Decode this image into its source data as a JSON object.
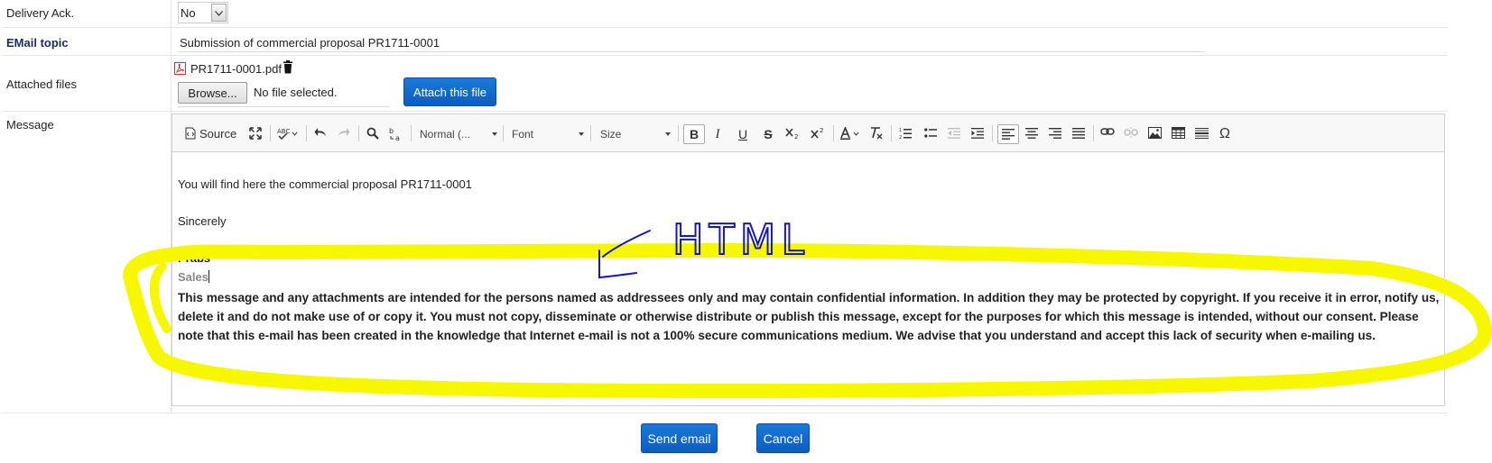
{
  "delivery_ack": {
    "label": "Delivery Ack.",
    "value": "No"
  },
  "email_topic": {
    "label": "EMail topic",
    "value": "Submission of commercial proposal PR1711-0001"
  },
  "attached_files": {
    "label": "Attached files",
    "file_name": "PR1711-0001.pdf",
    "browse_label": "Browse...",
    "no_file_text": "No file selected.",
    "attach_label": "Attach this file"
  },
  "message": {
    "label": "Message",
    "toolbar": {
      "source_label": "Source",
      "format_label": "Normal (...",
      "font_label": "Font",
      "size_label": "Size"
    },
    "body": {
      "line1": "You will find here the commercial proposal PR1711-0001",
      "line2": "Sincerely",
      "line3": "Prabs",
      "line4": "Sales",
      "disclaimer": "This message and any attachments are intended for the persons named as addressees only and may contain confidential information. In addition they may be protected by copyright. If you receive it in error, notify us, delete it and do not make use of or copy it. You must not copy, disseminate or otherwise distribute or publish this message, except for the purposes for which this message is intended, without our consent. Please note that this e-mail has been created in the knowledge that Internet e-mail is not a 100% secure communications medium. We advise that you understand and accept this lack of security when e-mailing us."
    }
  },
  "buttons": {
    "send_label": "Send email",
    "cancel_label": "Cancel"
  },
  "annotation": {
    "text": "HTML",
    "highlight_color": "#f7f700",
    "ink_color": "#1515c8"
  },
  "colors": {
    "button_blue": "#0b5dc2",
    "label_bold": "#1f2a68"
  }
}
